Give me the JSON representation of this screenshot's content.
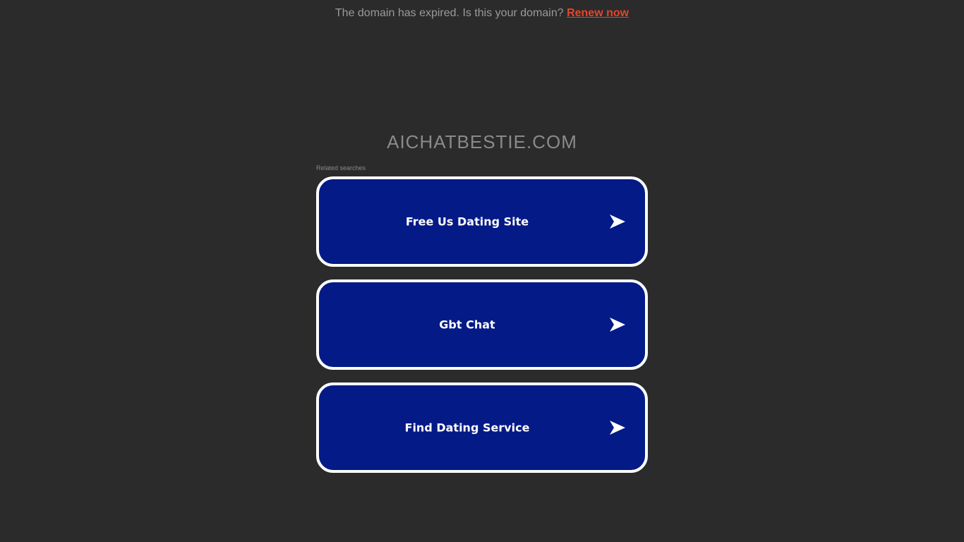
{
  "banner": {
    "text": "The domain has expired. Is this your domain?",
    "link_label": "Renew now",
    "link_color": "#e2462c"
  },
  "domain": {
    "name": "AICHATBESTIE.COM"
  },
  "related": {
    "label": "Related searches",
    "items": [
      {
        "label": "Free Us Dating Site",
        "icon": "arrow-right-icon"
      },
      {
        "label": "Gbt Chat",
        "icon": "arrow-right-icon"
      },
      {
        "label": "Find Dating Service",
        "icon": "arrow-right-icon"
      }
    ]
  },
  "colors": {
    "background": "#2b2b2b",
    "button_fill": "#041a87",
    "button_border": "#ffffff"
  }
}
